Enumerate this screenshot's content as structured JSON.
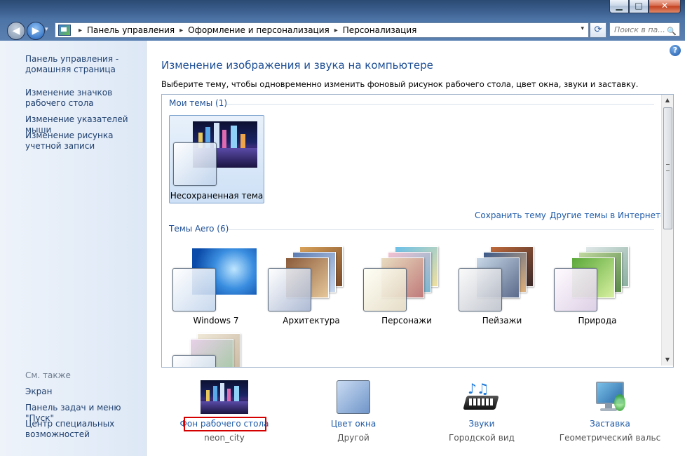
{
  "window": {
    "btn_min": "▁",
    "btn_max": "□",
    "btn_close": "✕"
  },
  "nav": {
    "back_icon": "◀",
    "fwd_icon": "▶",
    "drop": "▾",
    "refresh_icon": "⟳"
  },
  "address": {
    "parts": [
      "Панель управления",
      "Оформление и персонализация",
      "Персонализация"
    ],
    "sep": "▸"
  },
  "search": {
    "placeholder": "Поиск в па...",
    "icon": "🔍"
  },
  "sidebar": {
    "links": [
      "Панель управления - домашняя страница",
      "Изменение значков рабочего стола",
      "Изменение указателей мыши",
      "Изменение рисунка учетной записи"
    ],
    "see_also_title": "См. также",
    "see_also": [
      "Экран",
      "Панель задач и меню \"Пуск\"",
      "Центр специальных возможностей"
    ]
  },
  "main": {
    "title": "Изменение изображения и звука на компьютере",
    "subtitle": "Выберите тему, чтобы одновременно изменить фоновый рисунок рабочего стола, цвет окна, звуки и заставку.",
    "help_icon": "?",
    "my_themes": {
      "label": "Мои темы (1)",
      "items": [
        "Несохраненная тема"
      ]
    },
    "save_theme": "Сохранить тему",
    "more_themes": "Другие темы в Интернете",
    "aero_themes": {
      "label": "Темы Aero (6)",
      "items": [
        "Windows 7",
        "Архитектура",
        "Персонажи",
        "Пейзажи",
        "Природа"
      ]
    }
  },
  "bottom": {
    "items": [
      {
        "link": "Фон рабочего стола",
        "value": "neon_city"
      },
      {
        "link": "Цвет окна",
        "value": "Другой"
      },
      {
        "link": "Звуки",
        "value": "Городской вид"
      },
      {
        "link": "Заставка",
        "value": "Геометрический вальс"
      }
    ]
  },
  "colors": {
    "accent": "#1e5aa8",
    "title": "#1e4f95",
    "highlight_border": "#d40000"
  }
}
